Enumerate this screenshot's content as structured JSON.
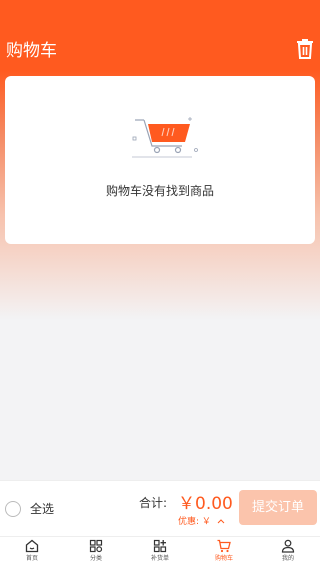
{
  "header": {
    "title": "购物车",
    "trash_icon": "trash-icon"
  },
  "cart": {
    "empty_text": "购物车没有找到商品",
    "illustration_icon": "empty-cart-illustration"
  },
  "checkout": {
    "select_all_label": "全选",
    "total_label": "合计:",
    "total_value": "￥0.00",
    "discount_label": "优惠: ￥",
    "discount_icon": "chevron-up-icon",
    "submit_label": "提交订单"
  },
  "tabs": [
    {
      "label": "首页",
      "icon": "home-icon"
    },
    {
      "label": "分类",
      "icon": "category-icon"
    },
    {
      "label": "补货单",
      "icon": "restock-icon"
    },
    {
      "label": "购物车",
      "icon": "cart-icon",
      "active": true
    },
    {
      "label": "我的",
      "icon": "user-icon"
    }
  ],
  "colors": {
    "accent": "#ff5a1f",
    "submit_disabled": "#fbc4ac",
    "background": "#f3f3f5"
  }
}
